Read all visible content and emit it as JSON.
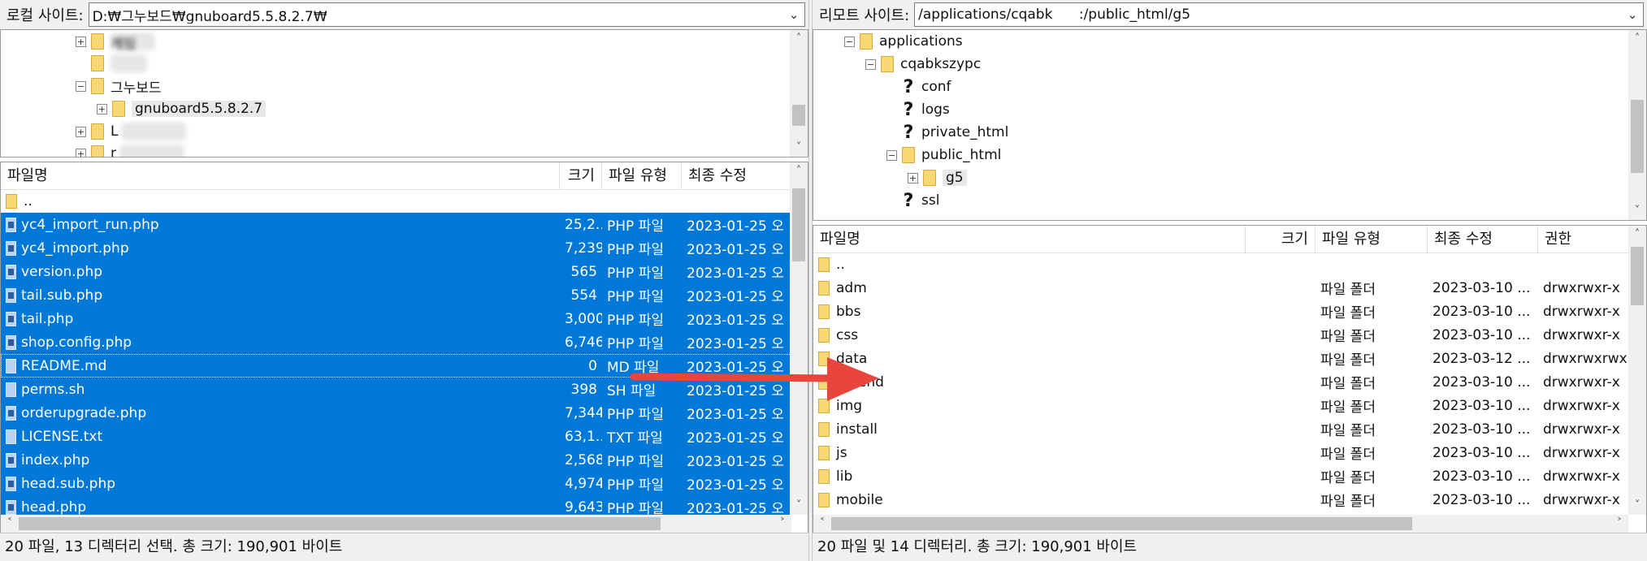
{
  "local": {
    "site_label": "로컬 사이트:",
    "path": "D:₩그누보드₩gnuboard5.5.8.2.7₩",
    "tree": [
      {
        "label": "게임",
        "blurred": true
      },
      {
        "label": "",
        "blurred": true
      },
      {
        "label": "그누보드"
      },
      {
        "label": "gnuboard5.5.8.2.7"
      },
      {
        "label": "L",
        "blurred": true
      },
      {
        "label": "r",
        "blurred": true
      }
    ],
    "columns": {
      "name": "파일명",
      "size": "크기",
      "type": "파일 유형",
      "modified": "최종 수정"
    },
    "parent_row": "..",
    "files": [
      {
        "name": "yc4_import_run.php",
        "size": "25,2...",
        "type": "PHP 파일",
        "modified": "2023-01-25 오"
      },
      {
        "name": "yc4_import.php",
        "size": "7,239",
        "type": "PHP 파일",
        "modified": "2023-01-25 오"
      },
      {
        "name": "version.php",
        "size": "565",
        "type": "PHP 파일",
        "modified": "2023-01-25 오"
      },
      {
        "name": "tail.sub.php",
        "size": "554",
        "type": "PHP 파일",
        "modified": "2023-01-25 오"
      },
      {
        "name": "tail.php",
        "size": "3,000",
        "type": "PHP 파일",
        "modified": "2023-01-25 오"
      },
      {
        "name": "shop.config.php",
        "size": "6,746",
        "type": "PHP 파일",
        "modified": "2023-01-25 오"
      },
      {
        "name": "README.md",
        "size": "0",
        "type": "MD 파일",
        "modified": "2023-01-25 오"
      },
      {
        "name": "perms.sh",
        "size": "398",
        "type": "SH 파일",
        "modified": "2023-01-25 오"
      },
      {
        "name": "orderupgrade.php",
        "size": "7,344",
        "type": "PHP 파일",
        "modified": "2023-01-25 오"
      },
      {
        "name": "LICENSE.txt",
        "size": "63,1...",
        "type": "TXT 파일",
        "modified": "2023-01-25 오"
      },
      {
        "name": "index.php",
        "size": "2,568",
        "type": "PHP 파일",
        "modified": "2023-01-25 오"
      },
      {
        "name": "head.sub.php",
        "size": "4,974",
        "type": "PHP 파일",
        "modified": "2023-01-25 오"
      },
      {
        "name": "head.php",
        "size": "9,643",
        "type": "PHP 파일",
        "modified": "2023-01-25 오"
      }
    ],
    "status": "20 파일, 13 디렉터리 선택. 총 크기: 190,901 바이트"
  },
  "remote": {
    "site_label": "리모트 사이트:",
    "path": "/applications/cqabk      :/public_html/g5",
    "tree": [
      {
        "label": "applications"
      },
      {
        "label": "cqabkszypc"
      },
      {
        "label": "conf"
      },
      {
        "label": "logs"
      },
      {
        "label": "private_html"
      },
      {
        "label": "public_html"
      },
      {
        "label": "g5"
      },
      {
        "label": "ssl"
      }
    ],
    "columns": {
      "name": "파일명",
      "size": "크기",
      "type": "파일 유형",
      "modified": "최종 수정",
      "perm": "권한"
    },
    "parent_row": "..",
    "folders": [
      {
        "name": "adm",
        "type": "파일 폴더",
        "modified": "2023-03-10 ...",
        "perm": "drwxrwxr-x"
      },
      {
        "name": "bbs",
        "type": "파일 폴더",
        "modified": "2023-03-10 ...",
        "perm": "drwxrwxr-x"
      },
      {
        "name": "css",
        "type": "파일 폴더",
        "modified": "2023-03-10 ...",
        "perm": "drwxrwxr-x"
      },
      {
        "name": "data",
        "type": "파일 폴더",
        "modified": "2023-03-12 ...",
        "perm": "drwxrwxrwx"
      },
      {
        "name": "extend",
        "type": "파일 폴더",
        "modified": "2023-03-10 ...",
        "perm": "drwxrwxr-x"
      },
      {
        "name": "img",
        "type": "파일 폴더",
        "modified": "2023-03-10 ...",
        "perm": "drwxrwxr-x"
      },
      {
        "name": "install",
        "type": "파일 폴더",
        "modified": "2023-03-10 ...",
        "perm": "drwxrwxr-x"
      },
      {
        "name": "js",
        "type": "파일 폴더",
        "modified": "2023-03-10 ...",
        "perm": "drwxrwxr-x"
      },
      {
        "name": "lib",
        "type": "파일 폴더",
        "modified": "2023-03-10 ...",
        "perm": "drwxrwxr-x"
      },
      {
        "name": "mobile",
        "type": "파일 폴더",
        "modified": "2023-03-10 ...",
        "perm": "drwxrwxr-x"
      }
    ],
    "status": "20 파일 및 14 디렉터리. 총 크기: 190,901 바이트"
  },
  "colors": {
    "selection": "#0078d7",
    "arrow": "#e8453c",
    "folder": "#f8d775"
  }
}
